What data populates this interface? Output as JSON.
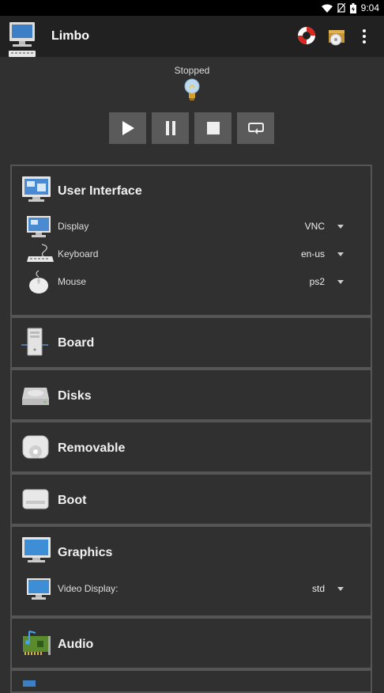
{
  "status_bar": {
    "time": "9:04"
  },
  "app": {
    "title": "Limbo"
  },
  "vm": {
    "status": "Stopped"
  },
  "sections": {
    "user_interface": {
      "title": "User Interface",
      "display": {
        "label": "Display",
        "value": "VNC"
      },
      "keyboard": {
        "label": "Keyboard",
        "value": "en-us"
      },
      "mouse": {
        "label": "Mouse",
        "value": "ps2"
      }
    },
    "board": {
      "title": "Board"
    },
    "disks": {
      "title": "Disks"
    },
    "removable": {
      "title": "Removable"
    },
    "boot": {
      "title": "Boot"
    },
    "graphics": {
      "title": "Graphics",
      "video_display": {
        "label": "Video Display:",
        "value": "std"
      }
    },
    "audio": {
      "title": "Audio"
    }
  },
  "colors": {
    "background": "#303030",
    "appbar": "#212121",
    "button": "#5a5a5a",
    "border": "#555555"
  }
}
